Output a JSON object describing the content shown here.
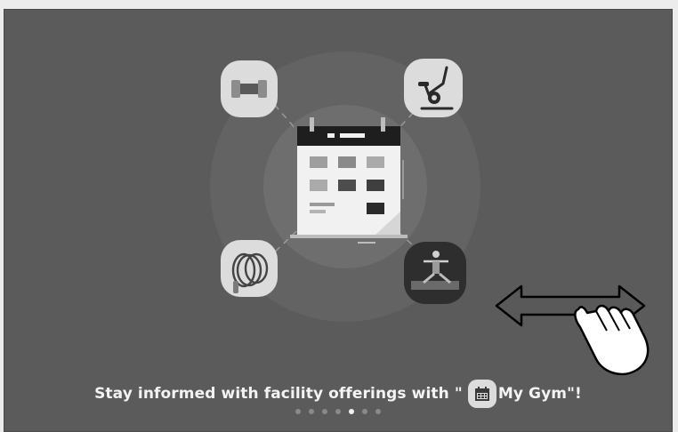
{
  "caption": {
    "prefix": "Stay informed with facility offerings with \"",
    "app_icon": "calendar-icon",
    "app_name": "My Gym",
    "suffix": "\"!"
  },
  "features": [
    {
      "name": "strength-training",
      "icon": "dumbbell-icon"
    },
    {
      "name": "cardio",
      "icon": "exercise-bike-icon"
    },
    {
      "name": "jump-rope",
      "icon": "jump-rope-icon"
    },
    {
      "name": "yoga",
      "icon": "yoga-pose-icon"
    }
  ],
  "pagination": {
    "total": 7,
    "active_index": 4
  },
  "gesture_hint": {
    "icon": "swipe-hand-icon",
    "direction": "horizontal"
  },
  "colors": {
    "background": "#5b5b5b",
    "caption_text": "#f3f3f3",
    "dot_active": "#f2f2f2",
    "dot_inactive": "#8a8a8a"
  }
}
